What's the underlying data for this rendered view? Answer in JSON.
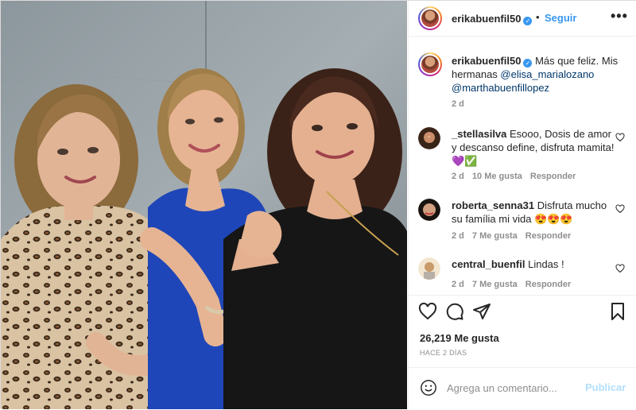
{
  "post": {
    "username": "erikabuenfil50",
    "follow_label": "Seguir",
    "separator": "•",
    "more_label": "•••",
    "caption": {
      "text_start": "Más que feliz. Mis hermanas ",
      "mention1": "@elisa_marialozano",
      "mention2": "@marthabuenfillopez",
      "time": "2 d"
    }
  },
  "comments": [
    {
      "username": "_stellasilva",
      "text": "Esooo, Dosis de amor y descanso define, disfruta mamita! 💜✅",
      "time": "2 d",
      "likes": "10 Me gusta",
      "reply": "Responder"
    },
    {
      "username": "roberta_senna31",
      "text": "Disfruta mucho su família mi vida 😍😍😍",
      "time": "2 d",
      "likes": "7 Me gusta",
      "reply": "Responder"
    },
    {
      "username": "central_buenfil",
      "text": "Lindas !",
      "time": "2 d",
      "likes": "7 Me gusta",
      "reply": "Responder"
    }
  ],
  "actions": {
    "icons": [
      "heart-icon",
      "comment-icon",
      "share-icon",
      "bookmark-icon"
    ],
    "likes": "26,219 Me gusta",
    "posted": "HACE 2 DÍAS"
  },
  "add_comment": {
    "placeholder": "Agrega un comentario...",
    "publish_label": "Publicar"
  },
  "colors": {
    "link": "#3897f0",
    "mention": "#00376b",
    "muted": "#8e8e8e",
    "publish_disabled": "#b2dffc"
  }
}
